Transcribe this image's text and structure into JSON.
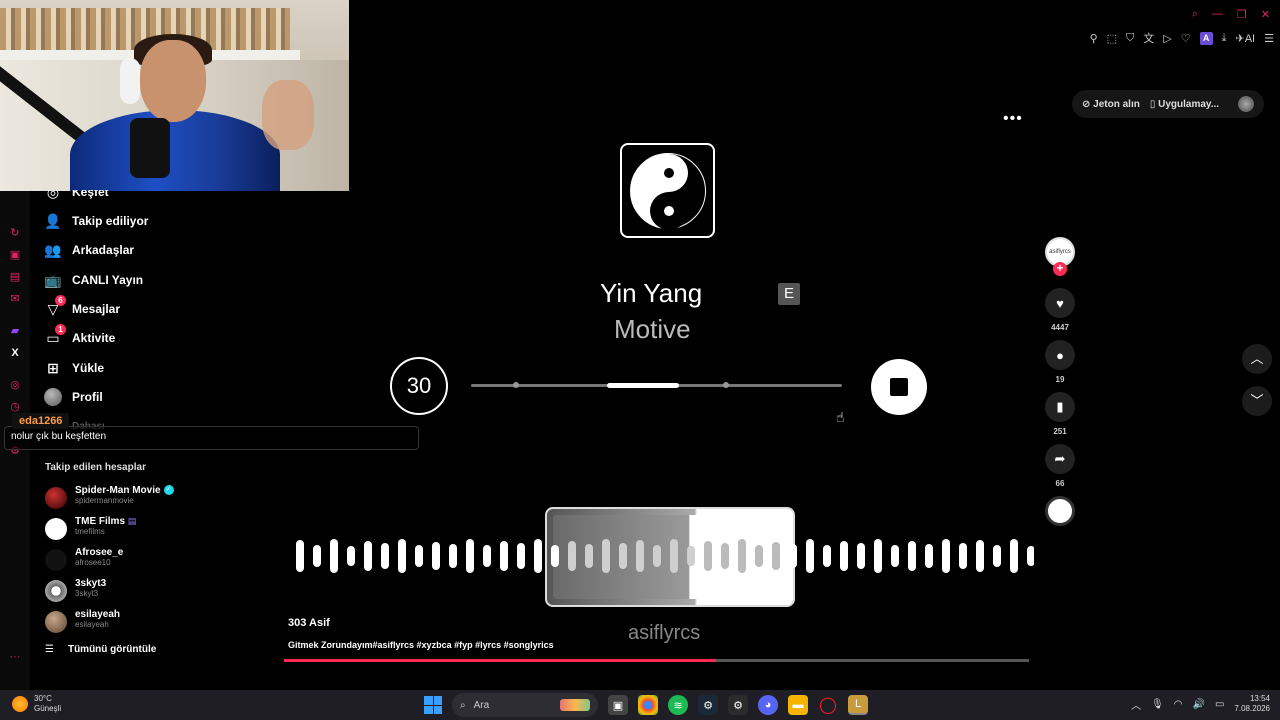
{
  "nav": {
    "items": [
      {
        "label": "Keşfet",
        "icon": "compass-icon",
        "badge": ""
      },
      {
        "label": "Takip ediliyor",
        "icon": "user-follow-icon",
        "badge": ""
      },
      {
        "label": "Arkadaşlar",
        "icon": "friends-icon",
        "badge": ""
      },
      {
        "label": "CANLI Yayın",
        "icon": "live-tv-icon",
        "badge": ""
      },
      {
        "label": "Mesajlar",
        "icon": "messages-icon",
        "badge": "6"
      },
      {
        "label": "Aktivite",
        "icon": "activity-icon",
        "badge": "1"
      },
      {
        "label": "Yükle",
        "icon": "upload-icon",
        "badge": ""
      },
      {
        "label": "Profil",
        "icon": "avatar-icon",
        "badge": ""
      }
    ],
    "more_label": "Dahası"
  },
  "chat": {
    "user": "eda1266",
    "message": "nolur çık bu keşfetten"
  },
  "followed": {
    "title": "Takip edilen hesaplar",
    "accounts": [
      {
        "name": "Spider-Man Movie",
        "handle": "spidermanmovie",
        "verified": true
      },
      {
        "name": "TME Films",
        "handle": "tmefilms",
        "verified": false
      },
      {
        "name": "Afrosee_e",
        "handle": "afrosee10",
        "verified": false
      },
      {
        "name": "3skyt3",
        "handle": "3skyt3",
        "verified": false
      },
      {
        "name": "esilayeah",
        "handle": "esilayeah",
        "verified": false
      }
    ],
    "see_all": "Tümünü görüntüle"
  },
  "header": {
    "coins": "Jeton alın",
    "app": "Uygulamay..."
  },
  "topbar_ext_label": "AI",
  "video": {
    "song_title": "Yin Yang",
    "explicit": "E",
    "artist": "Motive",
    "skip_label": "30",
    "watermark": "asiflyrcs",
    "author": "303 Asif",
    "caption": "Gitmek Zorundayım#asiflyrcs #xyzbca #fyp #lyrcs #songlyrics",
    "progress": 0.58,
    "seek_progress": 0.56
  },
  "actions": {
    "likes": "4447",
    "comments": "19",
    "saves": "251",
    "shares": "66",
    "creator_mark": "asiflyrcs"
  },
  "taskbar": {
    "temp": "30°C",
    "weather": "Güneşli",
    "search_placeholder": "Ara",
    "time": "13:54",
    "date": "7.08.2026"
  },
  "colors": {
    "accent": "#fe2c55",
    "background": "#000000",
    "taskbar": "#1e1e24"
  }
}
